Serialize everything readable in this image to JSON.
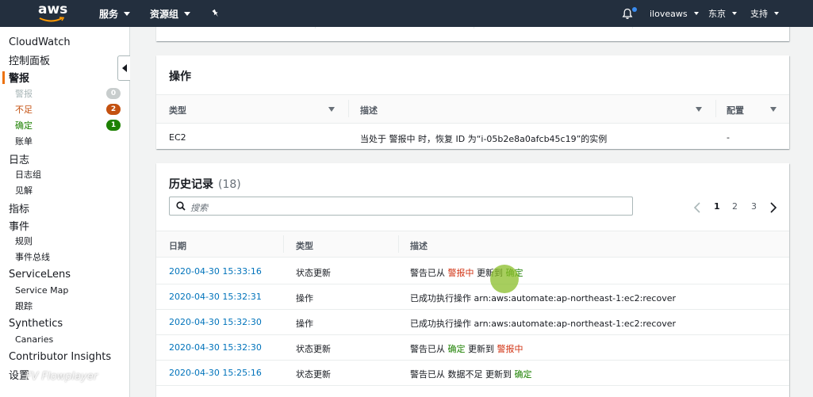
{
  "topnav": {
    "logo_text": "aws",
    "services": "服务",
    "resource_groups": "资源组",
    "user": "iloveaws",
    "region": "东京",
    "support": "支持"
  },
  "sidebar": {
    "cloudwatch": "CloudWatch",
    "dashboards": "控制面板",
    "alarms": "警报",
    "alarm_items": [
      {
        "label": "警报",
        "count": "0",
        "color": "#aab7b8",
        "text_color": "#aab7b8"
      },
      {
        "label": "不足",
        "count": "2",
        "color": "#c45110",
        "text_color": "#c45110"
      },
      {
        "label": "确定",
        "count": "1",
        "color": "#1d8102",
        "text_color": "#1d8102"
      }
    ],
    "billing": "账单",
    "logs": "日志",
    "log_groups": "日志组",
    "insights": "见解",
    "metrics": "指标",
    "events": "事件",
    "rules": "规则",
    "event_buses": "事件总线",
    "servicelens": "ServiceLens",
    "service_map": "Service Map",
    "traces": "跟踪",
    "synthetics": "Synthetics",
    "canaries": "Canaries",
    "contributor_insights": "Contributor Insights",
    "settings": "设置",
    "watermark": "FV Flowplayer"
  },
  "actions": {
    "title": "操作",
    "headers": {
      "type": "类型",
      "description": "描述",
      "config": "配置"
    },
    "row": {
      "type": "EC2",
      "description": "当处于 警报中 时，恢复 ID 为“i-05b2e8a0afcb45c19”的实例",
      "config": "-"
    }
  },
  "history": {
    "title": "历史记录",
    "count": "(18)",
    "search_placeholder": "搜索",
    "pages": [
      "1",
      "2",
      "3"
    ],
    "headers": {
      "date": "日期",
      "type": "类型",
      "description": "描述"
    },
    "rows": [
      {
        "date": "2020-04-30 15:33:16",
        "type": "状态更新",
        "d1": "警告已从 ",
        "s1": "警报中",
        "s1c": "red",
        "d2": " 更新到 ",
        "s2": "确定",
        "s2c": "green",
        "plain": ""
      },
      {
        "date": "2020-04-30 15:32:31",
        "type": "操作",
        "plain": "已成功执行操作 arn:aws:automate:ap-northeast-1:ec2:recover"
      },
      {
        "date": "2020-04-30 15:32:30",
        "type": "操作",
        "plain": "已成功执行操作 arn:aws:automate:ap-northeast-1:ec2:recover"
      },
      {
        "date": "2020-04-30 15:32:30",
        "type": "状态更新",
        "d1": "警告已从 ",
        "s1": "确定",
        "s1c": "green",
        "d2": " 更新到 ",
        "s2": "警报中",
        "s2c": "red",
        "plain": ""
      },
      {
        "date": "2020-04-30 15:25:16",
        "type": "状态更新",
        "d1": "警告已从 ",
        "s1": "数据不足",
        "s1c": "plain",
        "d2": " 更新到 ",
        "s2": "确定",
        "s2c": "green",
        "plain": ""
      }
    ]
  }
}
